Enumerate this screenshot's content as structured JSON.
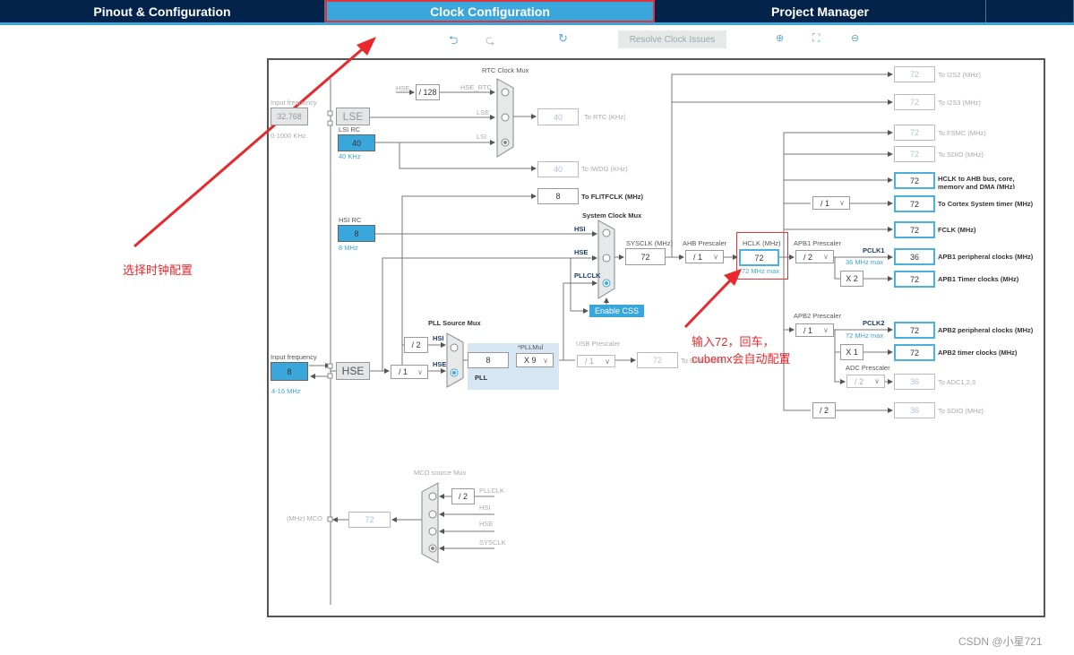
{
  "tabs": [
    "Pinout & Configuration",
    "Clock Configuration",
    "Project Manager"
  ],
  "toolbar": {
    "resolve": "Resolve Clock Issues",
    "icons": [
      "undo-icon",
      "redo-icon",
      "refresh-icon",
      "zoom-in-icon",
      "fit-icon",
      "zoom-out-icon"
    ]
  },
  "lse": {
    "label": "Input frequency",
    "value": "32.768",
    "range": "0-1000 KHz",
    "block": "LSE"
  },
  "lsi": {
    "label": "LSI RC",
    "value": "40",
    "unit": "40 KHz"
  },
  "hsi": {
    "label": "HSI RC",
    "value": "8",
    "unit": "8 MHz"
  },
  "hse": {
    "label": "Input frequency",
    "value": "8",
    "range": "4-16 MHz",
    "block": "HSE"
  },
  "rtc": {
    "title": "RTC Clock Mux",
    "hse": "HSE",
    "div": "/ 128",
    "hse_rtc": "HSE_RTC",
    "lse": "LSE",
    "lsi": "LSI",
    "value": "40",
    "out": "To RTC (KHz)"
  },
  "iwdg": {
    "value": "40",
    "out": "To IWDG (KHz)"
  },
  "flit": {
    "value": "8",
    "out": "To FLITFCLK (MHz)"
  },
  "sysmux": {
    "title": "System Clock Mux",
    "hsi": "HSI",
    "hse": "HSE",
    "pllclk": "PLLCLK",
    "css": "Enable CSS"
  },
  "sysclk": {
    "label": "SYSCLK (MHz)",
    "value": "72"
  },
  "ahb": {
    "label": "AHB Prescaler",
    "value": "/ 1"
  },
  "hclk": {
    "label": "HCLK (MHz)",
    "value": "72",
    "max": "72 MHz max"
  },
  "apb1": {
    "label": "APB1 Prescaler",
    "value": "/ 2",
    "pclk": "PCLK1",
    "max": "36 MHz max",
    "mult": "X 2"
  },
  "apb2": {
    "label": "APB2 Prescaler",
    "value": "/ 1",
    "pclk": "PCLK2",
    "max": "72 MHz max",
    "mult": "X 1"
  },
  "adc": {
    "label": "ADC Prescaler",
    "value": "/ 2"
  },
  "cortex_div": "/ 1",
  "sdio_div": "/ 2",
  "outputs": [
    {
      "value": "72",
      "label": "To I2S2 (MHz)"
    },
    {
      "value": "72",
      "label": "To I2S3 (MHz)"
    },
    {
      "value": "72",
      "label": "To FSMC (MHz)"
    },
    {
      "value": "72",
      "label": "To SDIO (MHz)"
    },
    {
      "value": "72",
      "label": "HCLK to AHB bus, core, memory and DMA (MHz)"
    },
    {
      "value": "72",
      "label": "To Cortex System timer (MHz)"
    },
    {
      "value": "72",
      "label": "FCLK (MHz)"
    },
    {
      "value": "36",
      "label": "APB1 peripheral clocks (MHz)"
    },
    {
      "value": "72",
      "label": "APB1 Timer clocks (MHz)"
    },
    {
      "value": "72",
      "label": "APB2 peripheral clocks (MHz)"
    },
    {
      "value": "72",
      "label": "APB2 timer clocks (MHz)"
    },
    {
      "value": "36",
      "label": "To ADC1,2,3"
    },
    {
      "value": "36",
      "label": "To SDIO (MHz)"
    }
  ],
  "pllsrc": {
    "title": "PLL Source Mux",
    "div": "/ 2",
    "hsi": "HSI",
    "hse": "HSE",
    "hse_div": "/ 1"
  },
  "pll": {
    "mul_label": "*PLLMul",
    "input": "8",
    "mul": "X 9",
    "label": "PLL"
  },
  "usb": {
    "label": "USB Prescaler",
    "value": "/ 1",
    "out_value": "72",
    "out": "To USB (MHz)"
  },
  "mco": {
    "title": "MCO source Mux",
    "div": "/ 2",
    "pllclk": "PLLCLK",
    "hsi": "HSI",
    "hse": "HSE",
    "sysclk": "SYSCLK",
    "value": "72",
    "label": "(MHz) MCO"
  },
  "annotations": {
    "a1": "选择时钟配置",
    "a2_line1": "输入72，回车，",
    "a2_line2": "cubemx会自动配置"
  },
  "watermark": "CSDN @小星721",
  "colors": {
    "nav": "#03234b",
    "accent": "#3aa7dc",
    "annotation": "#e8282c"
  }
}
